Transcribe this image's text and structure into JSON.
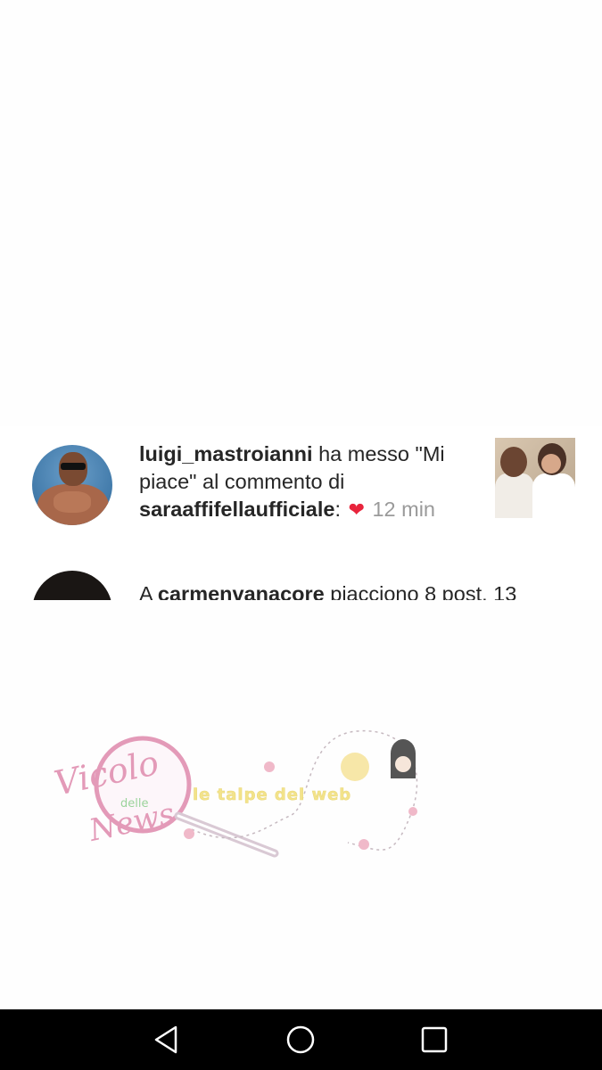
{
  "notifications": [
    {
      "username": "luigi_mastroianni",
      "text_before": " ha messo \"Mi piace\" al commento di ",
      "target_user": "saraaffifellaufficiale",
      "text_after": ":",
      "emoji": "❤",
      "time": "12 min"
    },
    {
      "prefix": "A ",
      "username": "carmenvanacore",
      "text": " piacciono 8 post. 13"
    }
  ],
  "watermark": {
    "logo_text_line1": "Vicolo",
    "logo_text_line2": "delle",
    "logo_text_line3": "News",
    "tagline": "le talpe del web"
  },
  "colors": {
    "text": "#262626",
    "timestamp": "#9a9a9a",
    "heart": "#e8243c",
    "watermark_pink": "#e39ab8",
    "watermark_yellow": "#f3e38a",
    "navbar": "#000000"
  },
  "navbar": {
    "back_icon": "back-triangle-icon",
    "home_icon": "home-circle-icon",
    "recent_icon": "recents-square-icon"
  }
}
